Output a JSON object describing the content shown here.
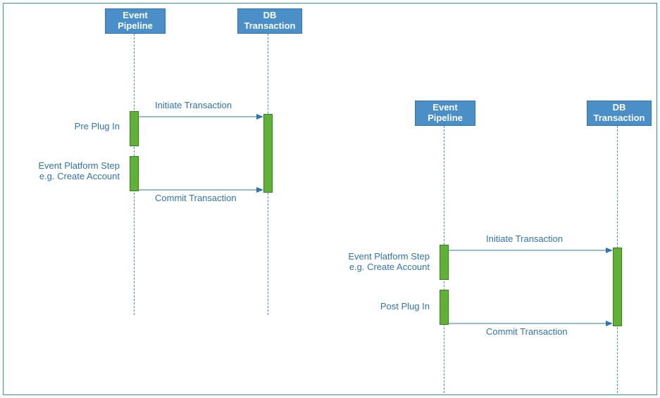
{
  "left": {
    "pipeline_header": "Event\nPipeline",
    "db_header": "DB\nTransaction",
    "label_pre": "Pre Plug In",
    "label_step_l1": "Event Platform Step",
    "label_step_l2": "e.g. Create Account",
    "msg_initiate": "Initiate Transaction",
    "msg_commit": "Commit Transaction"
  },
  "right": {
    "pipeline_header": "Event\nPipeline",
    "db_header": "DB\nTransaction",
    "label_step_l1": "Event Platform Step",
    "label_step_l2": "e.g. Create Account",
    "label_post": "Post Plug In",
    "msg_initiate": "Initiate Transaction",
    "msg_commit": "Commit Transaction"
  },
  "colors": {
    "lane_fill": "#4a8fc8",
    "activation_fill": "#5fb236",
    "text": "#2e75b6",
    "frame": "#2e9999"
  }
}
